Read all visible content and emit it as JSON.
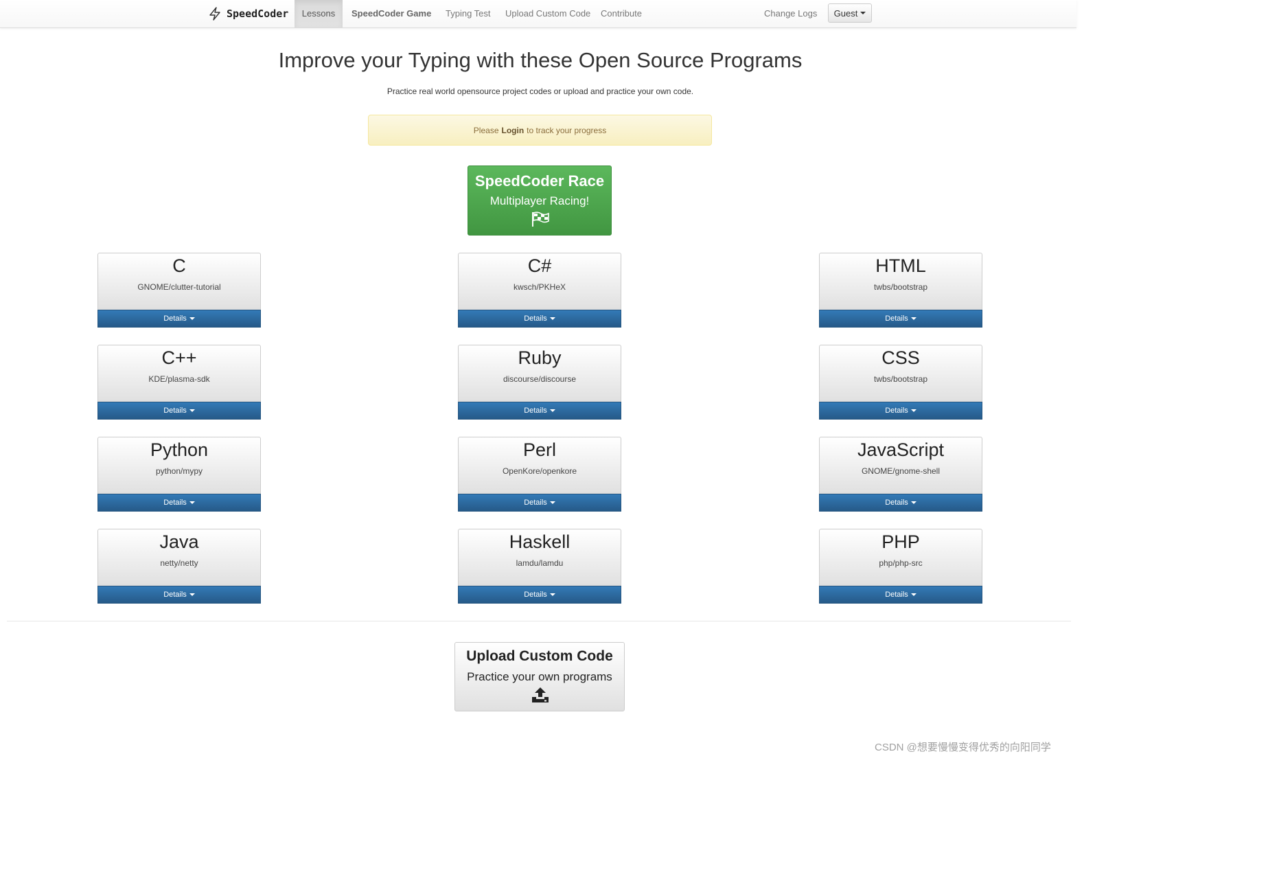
{
  "navbar": {
    "brand": "SpeedCoder",
    "brand_icon": "lightning-bolt-icon",
    "items": [
      {
        "label": "Lessons",
        "active": true
      },
      {
        "label": "SpeedCoder Game",
        "active": false
      },
      {
        "label": "Typing Test",
        "active": false
      },
      {
        "label": "Upload Custom Code",
        "active": false
      },
      {
        "label": "Contribute",
        "active": false
      }
    ],
    "change_logs": "Change Logs",
    "user_menu": "Guest"
  },
  "hero": {
    "title": "Improve your Typing with these Open Source Programs",
    "subtitle": "Practice real world opensource project codes or upload and practice your own code."
  },
  "alert": {
    "prefix": "Please",
    "link": "Login",
    "suffix": "to track your progress"
  },
  "race": {
    "title": "SpeedCoder Race",
    "subtitle": "Multiplayer Racing!",
    "icon": "checkered-flag-icon",
    "color": "#5cb85c"
  },
  "lessons": [
    {
      "language": "C",
      "repo": "GNOME/clutter-tutorial",
      "details": "Details"
    },
    {
      "language": "C#",
      "repo": "kwsch/PKHeX",
      "details": "Details"
    },
    {
      "language": "HTML",
      "repo": "twbs/bootstrap",
      "details": "Details"
    },
    {
      "language": "C++",
      "repo": "KDE/plasma-sdk",
      "details": "Details"
    },
    {
      "language": "Ruby",
      "repo": "discourse/discourse",
      "details": "Details"
    },
    {
      "language": "CSS",
      "repo": "twbs/bootstrap",
      "details": "Details"
    },
    {
      "language": "Python",
      "repo": "python/mypy",
      "details": "Details"
    },
    {
      "language": "Perl",
      "repo": "OpenKore/openkore",
      "details": "Details"
    },
    {
      "language": "JavaScript",
      "repo": "GNOME/gnome-shell",
      "details": "Details"
    },
    {
      "language": "Java",
      "repo": "netty/netty",
      "details": "Details"
    },
    {
      "language": "Haskell",
      "repo": "lamdu/lamdu",
      "details": "Details"
    },
    {
      "language": "PHP",
      "repo": "php/php-src",
      "details": "Details"
    }
  ],
  "upload": {
    "title": "Upload Custom Code",
    "subtitle": "Practice your own programs",
    "icon": "upload-icon"
  },
  "watermark": "CSDN @想要慢慢变得优秀的向阳同学",
  "colors": {
    "details_blue": "#337ab7",
    "race_green": "#5cb85c",
    "alert_bg": "#fcf8e3"
  }
}
